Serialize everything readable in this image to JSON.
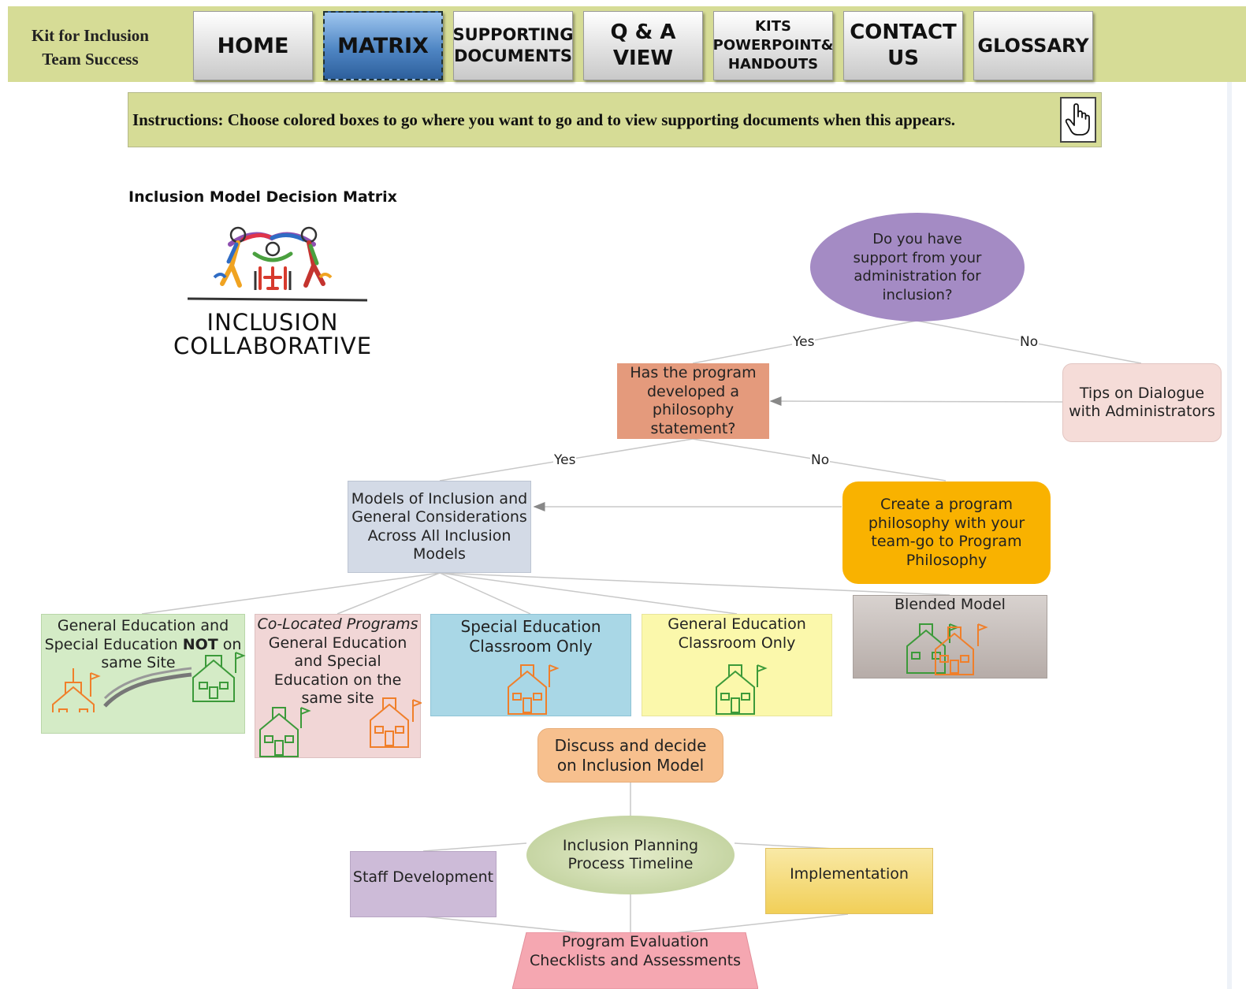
{
  "header": {
    "site_title_line1": "Kit for Inclusion",
    "site_title_line2": "Team Success",
    "nav": [
      {
        "line1": "HOME",
        "line2": ""
      },
      {
        "line1": "MATRIX",
        "line2": ""
      },
      {
        "line1": "SUPPORTING",
        "line2": "DOCUMENTS"
      },
      {
        "line1": "Q & A",
        "line2": "VIEW"
      },
      {
        "line1": "KITS",
        "line2": "POWERPOINT&",
        "line3": "HANDOUTS"
      },
      {
        "line1": "CONTACT",
        "line2": "US"
      },
      {
        "line1": "GLOSSARY",
        "line2": ""
      }
    ],
    "active_tab": "MATRIX"
  },
  "instructions": {
    "text": "Instructions: Choose colored boxes to go where you want to go and to view supporting documents when this appears."
  },
  "matrix": {
    "title": "Inclusion Model Decision Matrix",
    "logo_line1": "INCLUSION",
    "logo_line2": "COLLABORATIVE",
    "q_support": [
      "Do you have",
      "support from your",
      "administration for",
      "inclusion?"
    ],
    "tips_dialogue": [
      "Tips on Dialogue",
      "with Administrators"
    ],
    "q_philosophy": [
      "Has the program",
      "developed a",
      "philosophy",
      "statement?"
    ],
    "create_philosophy": [
      "Create a program",
      "philosophy with your",
      "team-go to Program",
      "Philosophy"
    ],
    "models_general": [
      "Models of Inclusion and",
      "General Considerations",
      "Across All Inclusion",
      "Models"
    ],
    "model_not_same_site": {
      "before": "General Education and",
      "line2_pre": "Special Education ",
      "line2_bold": "NOT",
      "line2_post": " on",
      "line3": "same Site"
    },
    "model_colocated": [
      "Co-Located Programs",
      "General Education",
      "and Special",
      "Education on the",
      "same site"
    ],
    "model_special_ed": [
      "Special Education",
      "Classroom Only"
    ],
    "model_general_ed": [
      "General Education",
      "Classroom Only"
    ],
    "model_blended": "Blended Model",
    "discuss_decide": [
      "Discuss and decide",
      "on Inclusion Model"
    ],
    "planning_timeline": [
      "Inclusion Planning",
      "Process Timeline"
    ],
    "staff_development": "Staff Development",
    "implementation": "Implementation",
    "program_evaluation": [
      "Program Evaluation",
      "Checklists and Assessments"
    ],
    "labels": {
      "yes1": "Yes",
      "no1": "No",
      "yes2": "Yes",
      "no2": "No"
    },
    "colors": {
      "header_bg": "#d6dc96",
      "q_support": "#a48bc4",
      "tips": "#f5dcd8",
      "q_philosophy": "#e49a7c",
      "create": "#f9b200",
      "models": "#d3dae6",
      "not_same_site": "#d4ebc6",
      "colocated": "#f1d6d6",
      "special_ed": "#a9d7e6",
      "general_ed": "#fbf8ab",
      "blended": "#bcb3b0",
      "discuss": "#f7c08e",
      "timeline": "#c7d6a4",
      "staff": "#cdbbd8",
      "implementation": "#f6dc7c",
      "evaluation": "#f5a7b1"
    }
  }
}
